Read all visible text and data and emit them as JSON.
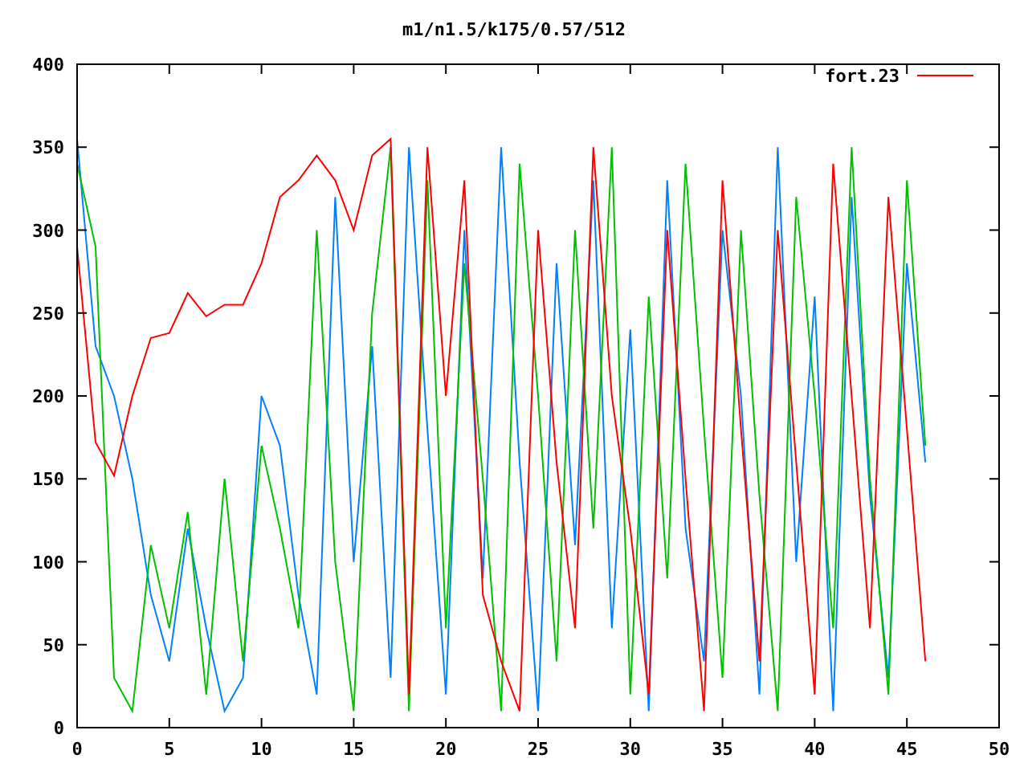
{
  "chart_data": {
    "type": "line",
    "title": "m1/n1.5/k175/0.57/512",
    "xlim": [
      0,
      50
    ],
    "ylim": [
      0,
      400
    ],
    "xticks": [
      0,
      5,
      10,
      15,
      20,
      25,
      30,
      35,
      40,
      45,
      50
    ],
    "yticks": [
      0,
      50,
      100,
      150,
      200,
      250,
      300,
      350,
      400
    ],
    "x": [
      0,
      1,
      2,
      3,
      4,
      5,
      6,
      7,
      8,
      9,
      10,
      11,
      12,
      13,
      14,
      15,
      16,
      17,
      18,
      19,
      20,
      21,
      22,
      23,
      24,
      25,
      26,
      27,
      28,
      29,
      30,
      31,
      32,
      33,
      34,
      35,
      36,
      37,
      38,
      39,
      40,
      41,
      42,
      43,
      44,
      45,
      46
    ],
    "series": [
      {
        "name": "fort.23",
        "color": "#ff0000",
        "values": [
          290,
          172,
          152,
          200,
          235,
          238,
          262,
          248,
          255,
          255,
          280,
          320,
          330,
          345,
          330,
          300,
          345,
          355,
          20,
          350,
          200,
          330,
          80,
          40,
          10,
          300,
          160,
          60,
          350,
          200,
          120,
          20,
          300,
          150,
          10,
          330,
          180,
          40,
          300,
          160,
          20,
          340,
          200,
          60,
          320,
          180,
          40
        ]
      },
      {
        "color": "#00c000",
        "values": [
          340,
          290,
          30,
          10,
          110,
          60,
          130,
          20,
          150,
          40,
          170,
          120,
          60,
          300,
          100,
          10,
          250,
          350,
          10,
          330,
          60,
          280,
          150,
          10,
          340,
          200,
          40,
          300,
          120,
          350,
          20,
          260,
          90,
          340,
          180,
          30,
          300,
          140,
          10,
          320,
          200,
          60,
          350,
          150,
          20,
          330,
          170
        ]
      },
      {
        "color": "#0080ff",
        "values": [
          355,
          230,
          200,
          150,
          80,
          40,
          120,
          60,
          10,
          30,
          200,
          170,
          80,
          20,
          320,
          100,
          230,
          30,
          350,
          180,
          20,
          300,
          90,
          350,
          160,
          10,
          280,
          110,
          330,
          60,
          240,
          10,
          330,
          120,
          40,
          300,
          200,
          20,
          350,
          100,
          260,
          10,
          320,
          140,
          30,
          280,
          160
        ]
      }
    ]
  }
}
